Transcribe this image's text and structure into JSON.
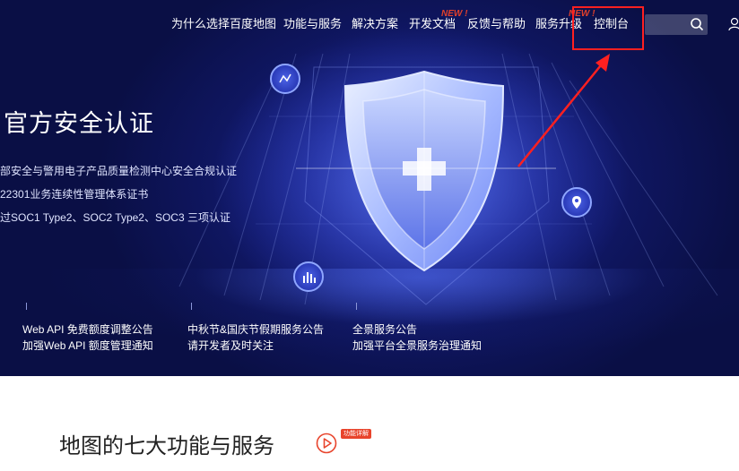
{
  "nav": {
    "items": [
      {
        "label": "为什么选择百度地图"
      },
      {
        "label": "功能与服务"
      },
      {
        "label": "解决方案"
      },
      {
        "label": "开发文档",
        "tag": "NEW !"
      },
      {
        "label": "反馈与帮助"
      },
      {
        "label": "服务升级",
        "tag": "NEW !"
      },
      {
        "label": "控制台"
      }
    ],
    "search_icon": "search-icon",
    "user_icon": "user-icon"
  },
  "hero": {
    "title": "官方安全认证",
    "bullets": [
      "部安全与警用电子产品质量检测中心安全合规认证",
      "22301业务连续性管理体系证书",
      "过SOC1 Type2、SOC2 Type2、SOC3 三项认证"
    ]
  },
  "notices": [
    {
      "title": "Web API 免费额度调整公告",
      "subtitle": "加强Web API 额度管理通知"
    },
    {
      "title": "中秋节&国庆节假期服务公告",
      "subtitle": "请开发者及时关注"
    },
    {
      "title": "全景服务公告",
      "subtitle": "加强平台全景服务治理通知"
    }
  ],
  "section": {
    "title": "地图的七大功能与服务",
    "tag": "功能详解"
  },
  "colors": {
    "accent_red": "#e8442c",
    "hero_blue": "#1e2a9a",
    "annotation_red": "#ff2020"
  }
}
